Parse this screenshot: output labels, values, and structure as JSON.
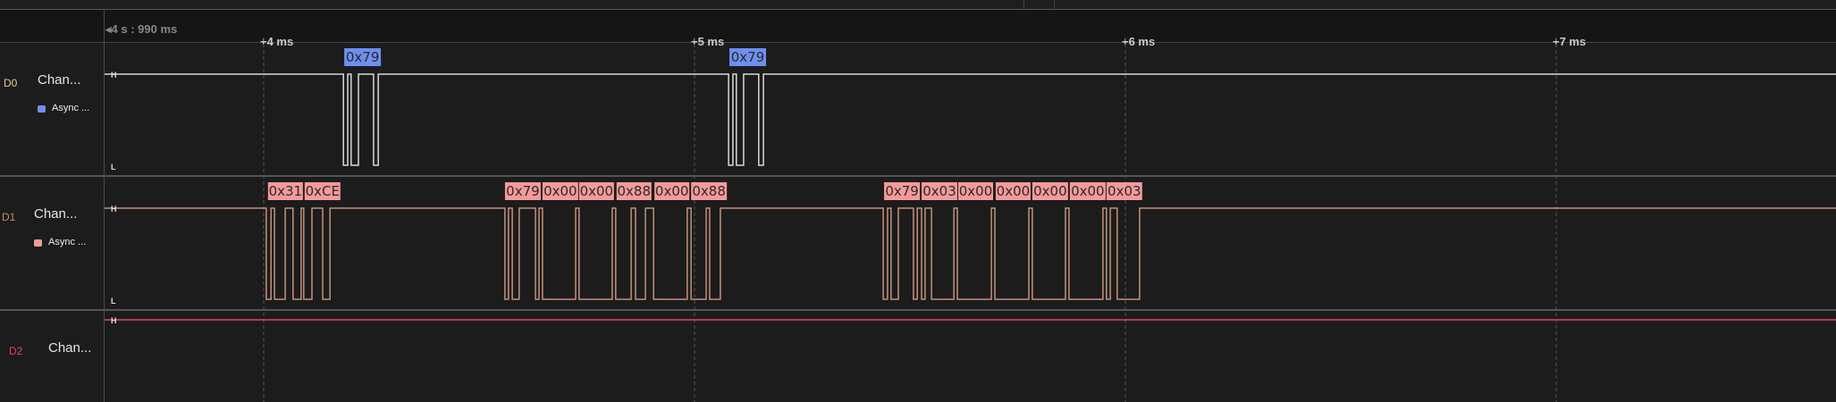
{
  "timeline": {
    "origin_label": "◂4 s : 990 ms",
    "ticks": [
      {
        "ms": 4,
        "label": "+4 ms"
      },
      {
        "ms": 5,
        "label": "+5 ms"
      },
      {
        "ms": 6,
        "label": "+6 ms"
      },
      {
        "ms": 7,
        "label": "+7 ms"
      }
    ]
  },
  "colors": {
    "d0": "#d8d8d8",
    "d0_id": "#e8c890",
    "d1": "#c4917a",
    "d1_id": "#d08a62",
    "d2": "#e0485a",
    "d2_id": "#e8404f",
    "label_blue": "#6e8ff0",
    "label_red": "#f59a9a"
  },
  "channels": [
    {
      "id": "D0",
      "name": "Chan...",
      "analyzer": "Async ...",
      "high": "H",
      "low": "L",
      "edges": [
        4.185,
        4.195,
        4.203,
        4.22,
        4.255,
        4.266,
        5.079,
        5.089,
        5.097,
        5.114,
        5.149,
        5.16
      ],
      "frames": [
        {
          "start": 4.187,
          "end": 4.272,
          "value": "0x79"
        },
        {
          "start": 5.081,
          "end": 5.166,
          "value": "0x79"
        }
      ]
    },
    {
      "id": "D1",
      "name": "Chan...",
      "analyzer": "Async ...",
      "high": "H",
      "low": "L",
      "edges": [
        4.006,
        4.017,
        4.025,
        4.05,
        4.068,
        4.087,
        4.093,
        4.112,
        4.137,
        4.154,
        4.56,
        4.568,
        4.577,
        4.593,
        4.631,
        4.639,
        4.647,
        4.724,
        4.732,
        4.809,
        4.817,
        4.853,
        4.863,
        4.886,
        4.905,
        4.983,
        4.992,
        5.027,
        5.035,
        5.06,
        5.438,
        5.448,
        5.456,
        5.473,
        5.508,
        5.517,
        5.527,
        5.535,
        5.55,
        5.602,
        5.61,
        5.689,
        5.697,
        5.776,
        5.784,
        5.861,
        5.869,
        5.948,
        5.956,
        5.965,
        5.981,
        6.033
      ],
      "frames": [
        {
          "start": 4.01,
          "end": 4.091,
          "value": "0x31"
        },
        {
          "start": 4.095,
          "end": 4.178,
          "value": "0xCE"
        },
        {
          "start": 4.56,
          "end": 4.643,
          "value": "0x79"
        },
        {
          "start": 4.647,
          "end": 4.73,
          "value": "0x00"
        },
        {
          "start": 4.732,
          "end": 4.813,
          "value": "0x00"
        },
        {
          "start": 4.819,
          "end": 4.9,
          "value": "0x88"
        },
        {
          "start": 4.907,
          "end": 4.988,
          "value": "0x00"
        },
        {
          "start": 4.992,
          "end": 5.075,
          "value": "0x88"
        },
        {
          "start": 5.44,
          "end": 5.523,
          "value": "0x79"
        },
        {
          "start": 5.527,
          "end": 5.61,
          "value": "0x03"
        },
        {
          "start": 5.612,
          "end": 5.693,
          "value": "0x00"
        },
        {
          "start": 5.699,
          "end": 5.78,
          "value": "0x00"
        },
        {
          "start": 5.784,
          "end": 5.867,
          "value": "0x00"
        },
        {
          "start": 5.871,
          "end": 5.954,
          "value": "0x00"
        },
        {
          "start": 5.956,
          "end": 6.039,
          "value": "0x03"
        }
      ]
    },
    {
      "id": "D2",
      "name": "Chan...",
      "high": "H",
      "edges": [],
      "frames": []
    }
  ]
}
